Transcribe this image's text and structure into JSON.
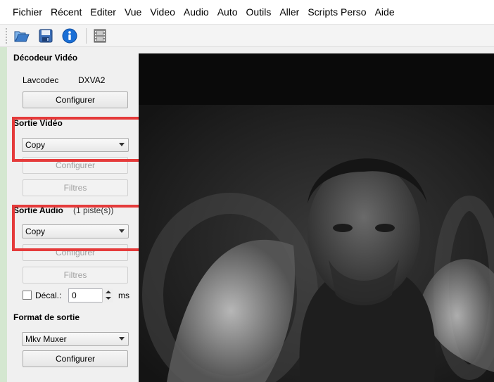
{
  "menu": [
    "Fichier",
    "Récent",
    "Editer",
    "Vue",
    "Video",
    "Audio",
    "Auto",
    "Outils",
    "Aller",
    "Scripts Perso",
    "Aide"
  ],
  "toolbar": {
    "icons": [
      "open-folder-icon",
      "save-floppy-icon",
      "info-icon",
      "film-icon"
    ]
  },
  "video_decoder": {
    "title": "Décodeur Vidéo",
    "lavcodec": "Lavcodec",
    "dxva": "DXVA2",
    "configure": "Configurer"
  },
  "video_output": {
    "title": "Sortie Vidéo",
    "selected": "Copy",
    "configure": "Configurer",
    "filters": "Filtres"
  },
  "audio_output": {
    "title": "Sortie Audio",
    "tracks": "(1 piste(s))",
    "selected": "Copy",
    "configure": "Configurer",
    "filters": "Filtres",
    "shift_label": "Décal.:",
    "shift_value": "0",
    "shift_unit": "ms"
  },
  "output_format": {
    "title": "Format de sortie",
    "selected": "Mkv Muxer",
    "configure": "Configurer"
  },
  "colors": {
    "highlight": "#e53b3b"
  }
}
